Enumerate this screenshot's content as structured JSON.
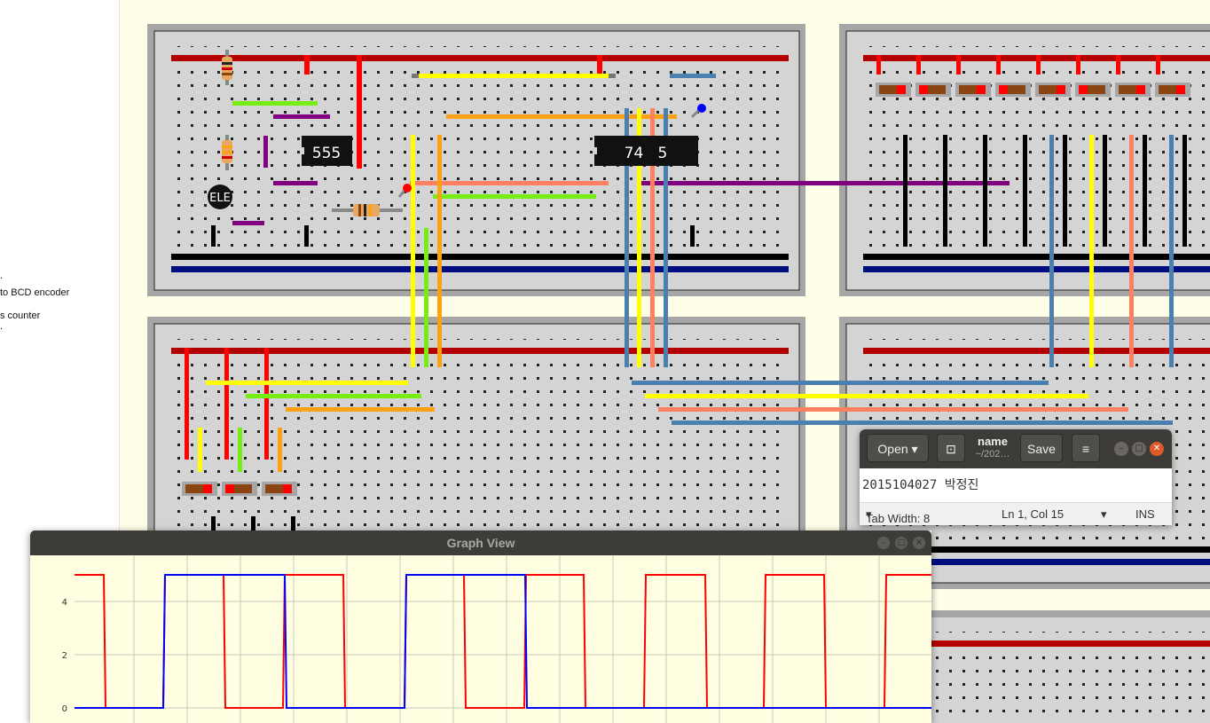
{
  "left_panel": {
    "items": [
      ".",
      "to BCD encoder",
      "s counter",
      "."
    ]
  },
  "chips": {
    "timer_label": "555",
    "counter_label": "74   5",
    "display_label": "ELE"
  },
  "colors": {
    "board": "#d4d4d4",
    "board_border": "#a6a6a6",
    "power_rail": "#b30000",
    "ground_rail": "#000000",
    "neg_rail": "#000d7f",
    "wire_yellow": "#ffff00",
    "wire_green": "#77ee11",
    "wire_orange": "#ffa011",
    "wire_purple": "#800080",
    "wire_blue": "#4a80b0",
    "wire_salmon": "#ff8060",
    "wire_red": "#ff0000",
    "trace_red": "#ff0000",
    "trace_blue": "#0000ff"
  },
  "gedit": {
    "open_label": "Open",
    "title": "name",
    "subtitle": "~/202…",
    "save_label": "Save",
    "menu_icon": "hamburger-icon",
    "pin_icon": "pin-icon",
    "content": "2015104027 박정진",
    "tab_width": "Tab Width: 8",
    "position": "Ln 1, Col 15",
    "mode": "INS"
  },
  "graph_view": {
    "title": "Graph View"
  },
  "chart_data": {
    "type": "line",
    "y_ticks": [
      "0",
      "2",
      "4"
    ],
    "ylim": [
      0,
      5.5
    ],
    "xlabel": "",
    "ylabel": "",
    "grid": true,
    "series": [
      {
        "color": "#ff0000",
        "x": [
          0,
          33,
          35,
          100,
          102,
          168,
          170,
          235,
          237,
          303,
          305,
          372,
          374,
          439,
          441,
          507,
          509,
          574,
          576,
          642,
          644,
          711,
          713,
          777,
          779,
          845,
          847,
          913,
          915,
          966
        ],
        "y": [
          5,
          5,
          0,
          0,
          5,
          5,
          0,
          0,
          5,
          5,
          0,
          0,
          5,
          5,
          0,
          0,
          5,
          5,
          0,
          0,
          5,
          5,
          0,
          0,
          5,
          5,
          0,
          0,
          5,
          5
        ]
      },
      {
        "color": "#0000ff",
        "x": [
          0,
          100,
          102,
          237,
          239,
          372,
          374,
          508,
          510,
          966
        ],
        "y": [
          0,
          0,
          5,
          5,
          0,
          0,
          5,
          5,
          0,
          0
        ]
      }
    ]
  }
}
